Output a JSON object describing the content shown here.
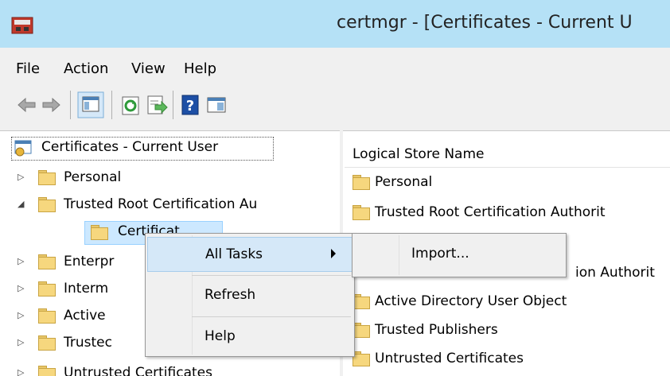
{
  "window": {
    "title": "certmgr - [Certificates - Current U"
  },
  "menu": [
    "File",
    "Action",
    "View",
    "Help"
  ],
  "toolbar": [
    "back-icon",
    "forward-icon",
    "show-hide-console-tree-icon",
    "refresh-icon",
    "export-list-icon",
    "help-icon",
    "show-action-pane-icon"
  ],
  "tree": {
    "root": "Certificates - Current User",
    "nodes": [
      {
        "label": "Personal",
        "expander": "collapsed"
      },
      {
        "label": "Trusted Root Certification Au",
        "expander": "expanded"
      },
      {
        "label": "Certificates",
        "expander": "none",
        "visible_text": "Certificat"
      },
      {
        "label": "Enterpr",
        "expander": "collapsed"
      },
      {
        "label": "Interm",
        "expander": "collapsed"
      },
      {
        "label": "Active",
        "expander": "collapsed"
      },
      {
        "label": "Trustec",
        "expander": "collapsed"
      },
      {
        "label": "Untrusted Certificates",
        "expander": "collapsed"
      }
    ]
  },
  "list": {
    "column_header": "Logical Store Name",
    "rows": [
      "Personal",
      "Trusted Root Certification Authorit",
      "",
      "ion Authorit",
      "Active Directory User Object",
      "Trusted Publishers",
      "Untrusted Certificates"
    ]
  },
  "context_menu": {
    "items": [
      "All Tasks",
      "Refresh",
      "Help"
    ],
    "highlighted": "All Tasks"
  },
  "submenu": {
    "items": [
      "Import..."
    ]
  },
  "colors": {
    "titlebar": "#b5e1f6",
    "chrome": "#f0f0f0",
    "highlight": "#d5e8f8",
    "folder": "#f6d77e"
  }
}
